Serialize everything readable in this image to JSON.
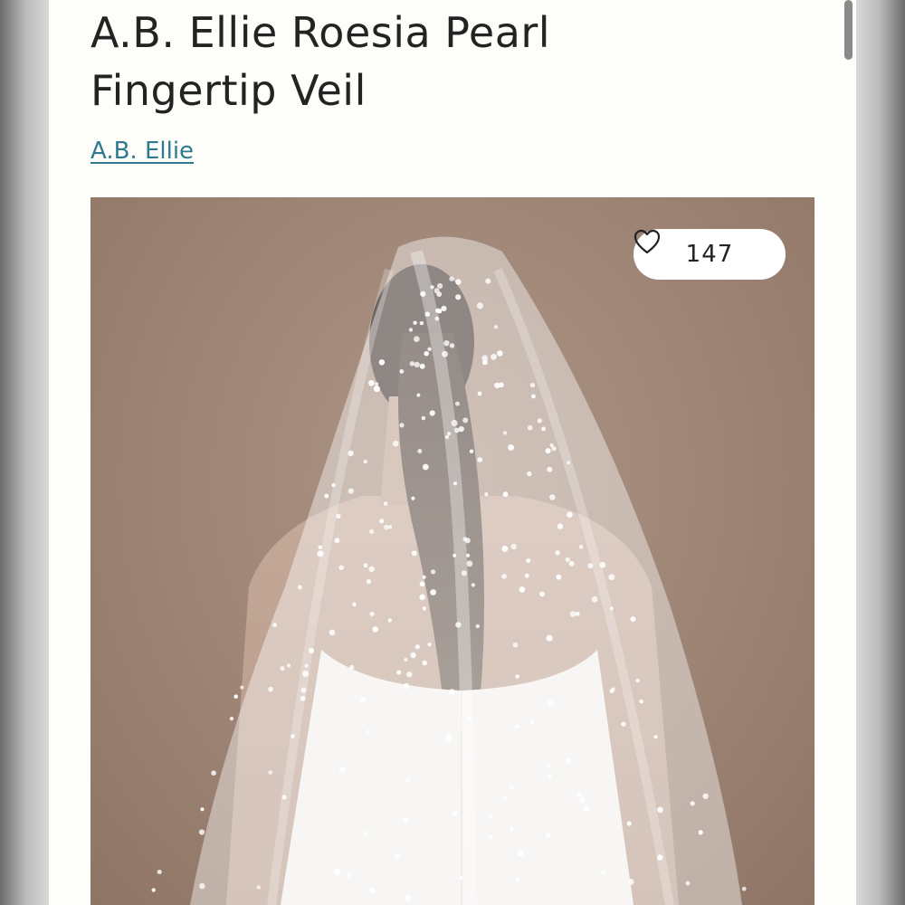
{
  "product": {
    "title": "A.B. Ellie Roesia Pearl Fingertip Veil",
    "brand_link": "A.B. Ellie"
  },
  "image": {
    "like_count": "147",
    "like_icon": "heart-outline-icon"
  },
  "colors": {
    "link": "#2f7a8f",
    "photo_background": "#9d8474",
    "page_background": "#fdfdf9"
  }
}
